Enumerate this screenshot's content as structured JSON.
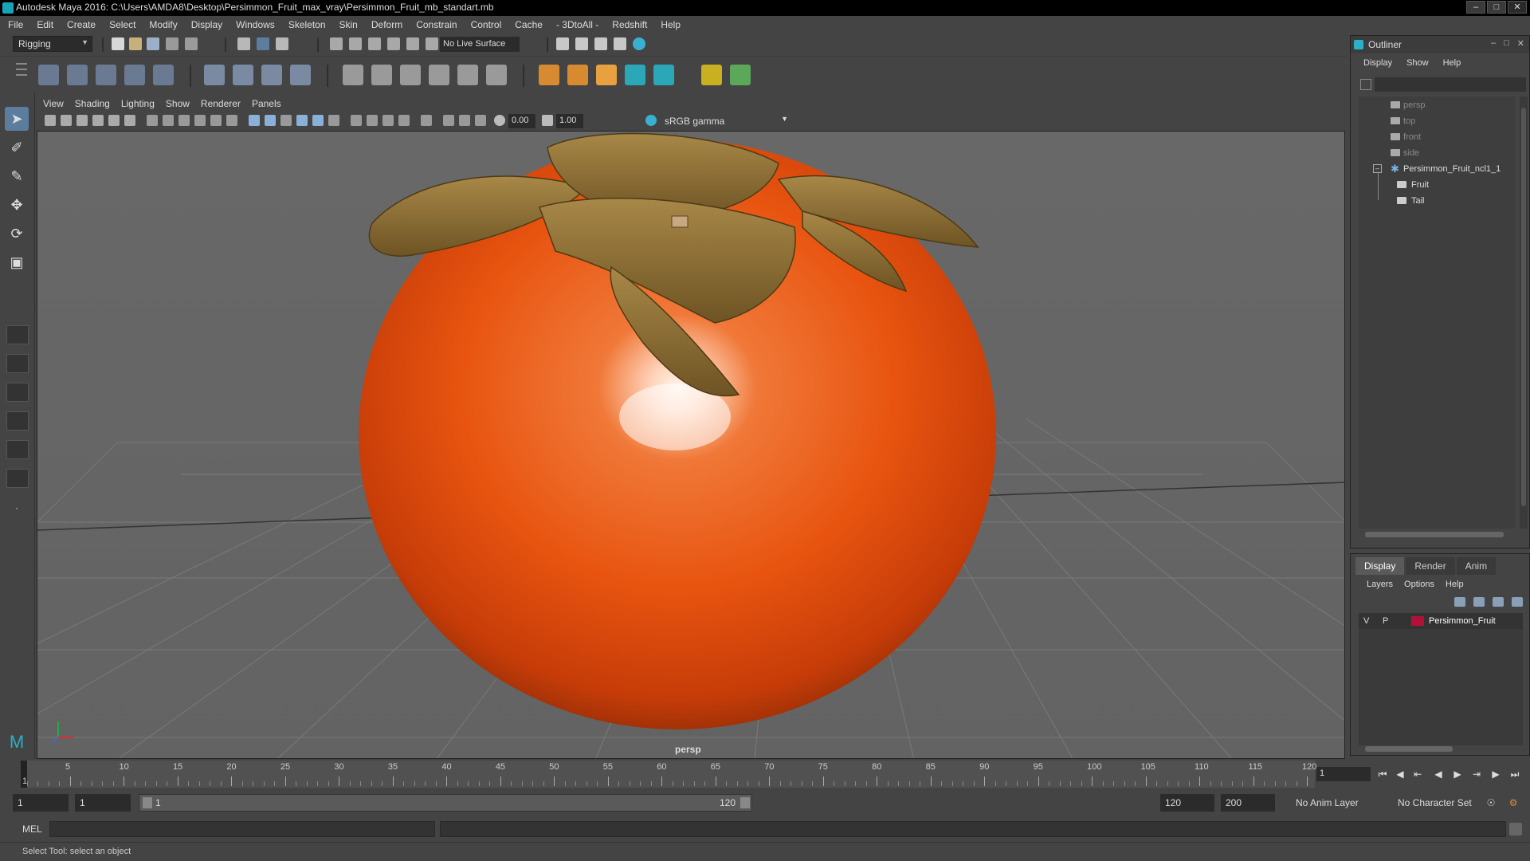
{
  "window": {
    "title": "Autodesk Maya 2016: C:\\Users\\AMDA8\\Desktop\\Persimmon_Fruit_max_vray\\Persimmon_Fruit_mb_standart.mb"
  },
  "menubar": [
    "File",
    "Edit",
    "Create",
    "Select",
    "Modify",
    "Display",
    "Windows",
    "Skeleton",
    "Skin",
    "Deform",
    "Constrain",
    "Control",
    "Cache",
    "- 3DtoAll -",
    "Redshift",
    "Help"
  ],
  "statusline": {
    "mode": "Rigging",
    "live_surface": "No Live Surface"
  },
  "panel_menu": [
    "View",
    "Shading",
    "Lighting",
    "Show",
    "Renderer",
    "Panels"
  ],
  "panel_toolbar": {
    "exposure": "0.00",
    "gamma": "1.00",
    "color_space": "sRGB gamma"
  },
  "viewport": {
    "camera_label": "persp"
  },
  "timeslider": {
    "ticks": [
      "5",
      "10",
      "15",
      "20",
      "25",
      "30",
      "35",
      "40",
      "45",
      "50",
      "55",
      "60",
      "65",
      "70",
      "75",
      "80",
      "85",
      "90",
      "95",
      "100",
      "105",
      "110",
      "115",
      "120"
    ],
    "first_tick": "1",
    "current_frame": "1"
  },
  "rangeslider": {
    "start_time": "1",
    "playback_start": "1",
    "bar_start": "1",
    "bar_end": "120",
    "playback_end": "120",
    "end_time": "200",
    "anim_layer": "No Anim Layer",
    "character_set": "No Character Set"
  },
  "cmdline": {
    "label": "MEL"
  },
  "helpline": {
    "text": "Select Tool: select an object"
  },
  "outliner": {
    "title": "Outliner",
    "menu": [
      "Display",
      "Show",
      "Help"
    ],
    "items": [
      {
        "label": "persp",
        "type": "camera"
      },
      {
        "label": "top",
        "type": "camera"
      },
      {
        "label": "front",
        "type": "camera"
      },
      {
        "label": "side",
        "type": "camera"
      },
      {
        "label": "Persimmon_Fruit_ncl1_1",
        "type": "group"
      },
      {
        "label": "Fruit",
        "type": "mesh"
      },
      {
        "label": "Tail",
        "type": "mesh"
      }
    ]
  },
  "layer_editor": {
    "tabs": [
      "Display",
      "Render",
      "Anim"
    ],
    "active_tab": "Display",
    "menu": [
      "Layers",
      "Options",
      "Help"
    ],
    "layers": [
      {
        "visible": "V",
        "playback": "P",
        "name": "Persimmon_Fruit",
        "color": "#b4103a"
      }
    ]
  },
  "colors": {
    "selection_accent": "#5d7d9e",
    "maya_teal": "#1aa3b8",
    "fruit_orange": "#e85410",
    "calyx_olive": "#8a6a2a"
  }
}
